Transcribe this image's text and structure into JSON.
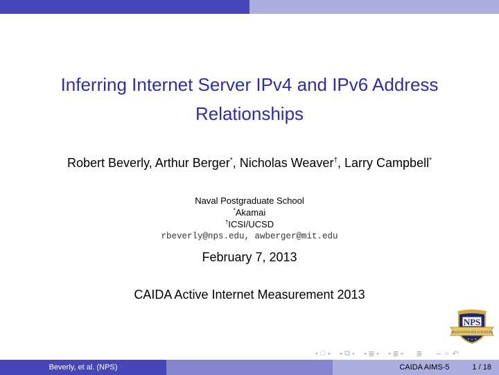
{
  "slide": {
    "title_lines": [
      "Inferring Internet Server IPv4 and IPv6 Address",
      "Relationships"
    ],
    "authors": [
      {
        "name": "Robert Beverly",
        "mark": ""
      },
      {
        "name": "Arthur Berger",
        "mark": "*"
      },
      {
        "name": "Nicholas Weaver",
        "mark": "†"
      },
      {
        "name": "Larry Campbell",
        "mark": "*"
      }
    ],
    "author_separator": ", ",
    "affiliations": [
      {
        "mark": "",
        "name": "Naval Postgraduate School"
      },
      {
        "mark": "*",
        "name": "Akamai"
      },
      {
        "mark": "†",
        "name": "ICSI/UCSD"
      }
    ],
    "emails": "rbeverly@nps.edu, awberger@mit.edu",
    "date": "February 7, 2013",
    "event": "CAIDA Active Internet Measurement 2013",
    "logo": {
      "text": "NPS",
      "motto": "PRAESTANTIA PER SCIENTIAM",
      "icon": "nps-crest-logo"
    }
  },
  "nav_symbols": {
    "frame": "□",
    "subsection": "⧉",
    "section": "≣",
    "appendix": "≣",
    "prev_arrow": "◂",
    "next_arrow": "▸",
    "search": "∽",
    "back": "↶",
    "find": "⌕"
  },
  "footer": {
    "author": "Beverly, et al.  (NPS)",
    "conference": "CAIDA AIMS-5",
    "page": "1 / 18"
  },
  "colors": {
    "dark": "#4646b9",
    "medium": "#8585ce",
    "light": "#adaee0",
    "title": "#2d2da8"
  }
}
